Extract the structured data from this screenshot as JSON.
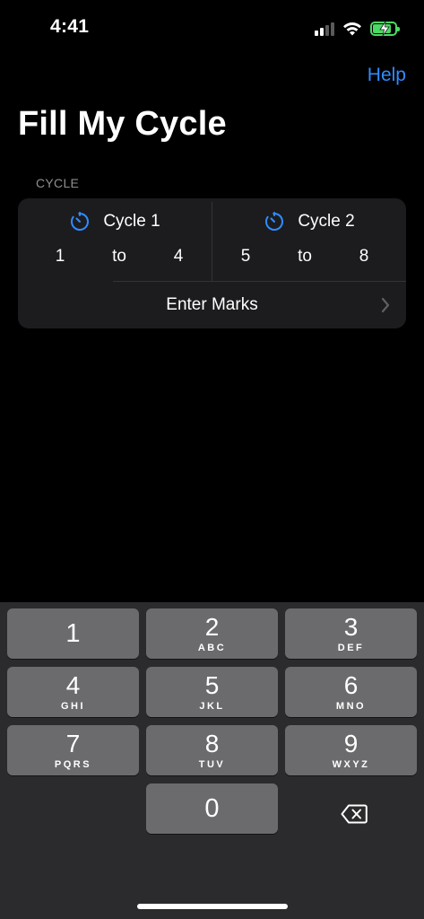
{
  "status_bar": {
    "time": "4:41",
    "signal_icon": "cellular-signal-icon",
    "wifi_icon": "wifi-icon",
    "battery_icon": "battery-charging-icon",
    "battery_color": "#4cd964"
  },
  "nav": {
    "help_label": "Help",
    "title": "Fill My Cycle",
    "accent_color": "#2f8cff"
  },
  "section": {
    "header": "CYCLE"
  },
  "cycles": [
    {
      "name": "Cycle 1",
      "icon": "timer-icon",
      "from": "1",
      "to_label": "to",
      "to": "4"
    },
    {
      "name": "Cycle 2",
      "icon": "timer-icon",
      "from": "5",
      "to_label": "to",
      "to": "8"
    }
  ],
  "enter_marks": {
    "label": "Enter Marks",
    "icon": "chevron-right-icon"
  },
  "keyboard": {
    "keys": [
      {
        "digit": "1",
        "letters": ""
      },
      {
        "digit": "2",
        "letters": "ABC"
      },
      {
        "digit": "3",
        "letters": "DEF"
      },
      {
        "digit": "4",
        "letters": "GHI"
      },
      {
        "digit": "5",
        "letters": "JKL"
      },
      {
        "digit": "6",
        "letters": "MNO"
      },
      {
        "digit": "7",
        "letters": "PQRS"
      },
      {
        "digit": "8",
        "letters": "TUV"
      },
      {
        "digit": "9",
        "letters": "WXYZ"
      },
      {
        "digit": "0",
        "letters": ""
      }
    ],
    "delete_icon": "delete-backspace-icon"
  }
}
